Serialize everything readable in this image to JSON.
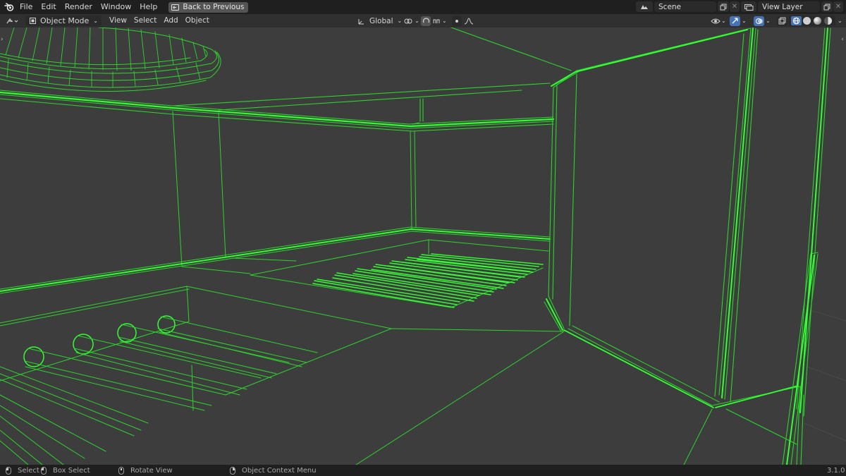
{
  "topbar": {
    "menus": [
      "File",
      "Edit",
      "Render",
      "Window",
      "Help"
    ],
    "back_button": "Back to Previous",
    "scene": {
      "value": "Scene"
    },
    "view_layer": {
      "value": "View Layer"
    }
  },
  "header": {
    "mode": "Object Mode",
    "menus": [
      "View",
      "Select",
      "Add",
      "Object"
    ],
    "transform_orientation": "Global"
  },
  "status": {
    "select": "Select",
    "box_select": "Box Select",
    "rotate_view": "Rotate View",
    "context_menu": "Object Context Menu",
    "version": "3.1.0"
  },
  "colors": {
    "wire": "#2cd42c",
    "wire_bright": "#33ff33",
    "background": "#3d3d3d",
    "accent_active": "#4772b3"
  },
  "icons": {
    "logo": "blender-logo-icon",
    "back": "back-arrow-icon",
    "scene": "scene-icon",
    "view_layer": "view-layer-icon",
    "editor_type": "editor-type-icon",
    "mode": "object-mode-icon",
    "snap": "snap-icon",
    "proportional": "proportional-edit-icon",
    "visibility": "visibility-icon",
    "gizmo": "gizmo-icon",
    "overlay": "overlay-icon",
    "xray": "xray-icon",
    "shading": [
      "wireframe-shading-icon",
      "solid-shading-icon",
      "material-shading-icon",
      "rendered-shading-icon"
    ]
  }
}
